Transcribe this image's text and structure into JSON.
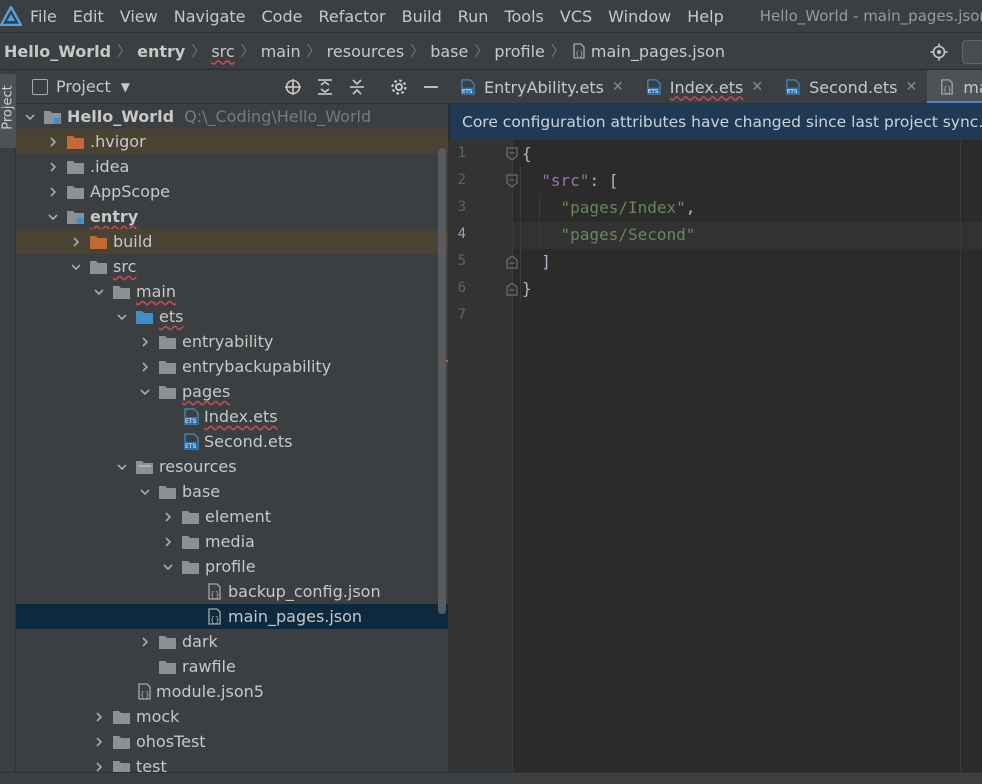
{
  "menubar": {
    "items": [
      "File",
      "Edit",
      "View",
      "Navigate",
      "Code",
      "Refactor",
      "Build",
      "Run",
      "Tools",
      "VCS",
      "Window",
      "Help"
    ],
    "window_title": "Hello_World - main_pages.json [e"
  },
  "breadcrumbs": [
    "Hello_World",
    "entry",
    "src",
    "main",
    "resources",
    "base",
    "profile",
    "main_pages.json"
  ],
  "left_strip": {
    "label": "Project"
  },
  "project_panel": {
    "title": "Project",
    "tree": [
      {
        "label": "Hello_World",
        "path": "Q:\\_Coding\\Hello_World"
      },
      {
        "label": ".hvigor"
      },
      {
        "label": ".idea"
      },
      {
        "label": "AppScope"
      },
      {
        "label": "entry"
      },
      {
        "label": "build"
      },
      {
        "label": "src"
      },
      {
        "label": "main"
      },
      {
        "label": "ets"
      },
      {
        "label": "entryability"
      },
      {
        "label": "entrybackupability"
      },
      {
        "label": "pages"
      },
      {
        "label": "Index.ets"
      },
      {
        "label": "Second.ets"
      },
      {
        "label": "resources"
      },
      {
        "label": "base"
      },
      {
        "label": "element"
      },
      {
        "label": "media"
      },
      {
        "label": "profile"
      },
      {
        "label": "backup_config.json"
      },
      {
        "label": "main_pages.json"
      },
      {
        "label": "dark"
      },
      {
        "label": "rawfile"
      },
      {
        "label": "module.json5"
      },
      {
        "label": "mock"
      },
      {
        "label": "ohosTest"
      },
      {
        "label": "test"
      }
    ]
  },
  "editor_tabs": [
    "EntryAbility.ets",
    "Index.ets",
    "Second.ets",
    "main_p"
  ],
  "banner": {
    "text": "Core configuration attributes have changed since last project sync. A pr"
  },
  "editor": {
    "line_numbers": [
      "1",
      "2",
      "3",
      "4",
      "5",
      "6",
      "7"
    ],
    "lines": [
      [
        {
          "t": "punct",
          "v": "{"
        }
      ],
      [
        {
          "t": "punct",
          "v": "  "
        },
        {
          "t": "key",
          "v": "\"src\""
        },
        {
          "t": "punct",
          "v": ": ["
        }
      ],
      [
        {
          "t": "punct",
          "v": "    "
        },
        {
          "t": "str",
          "v": "\"pages/Index\""
        },
        {
          "t": "punct",
          "v": ","
        }
      ],
      [
        {
          "t": "punct",
          "v": "    "
        },
        {
          "t": "str",
          "v": "\"pages/Second\""
        }
      ],
      [
        {
          "t": "punct",
          "v": "  ]"
        }
      ],
      [
        {
          "t": "punct",
          "v": "}"
        }
      ],
      []
    ]
  },
  "colors": {
    "accent": "#4a88c7",
    "selection": "#0d293e",
    "highlight": "#4a4232",
    "banner": "#1f3a52",
    "folder_orange": "#c26a35",
    "folder_blue": "#3d8fc6",
    "folder_gray": "#8b9196"
  }
}
